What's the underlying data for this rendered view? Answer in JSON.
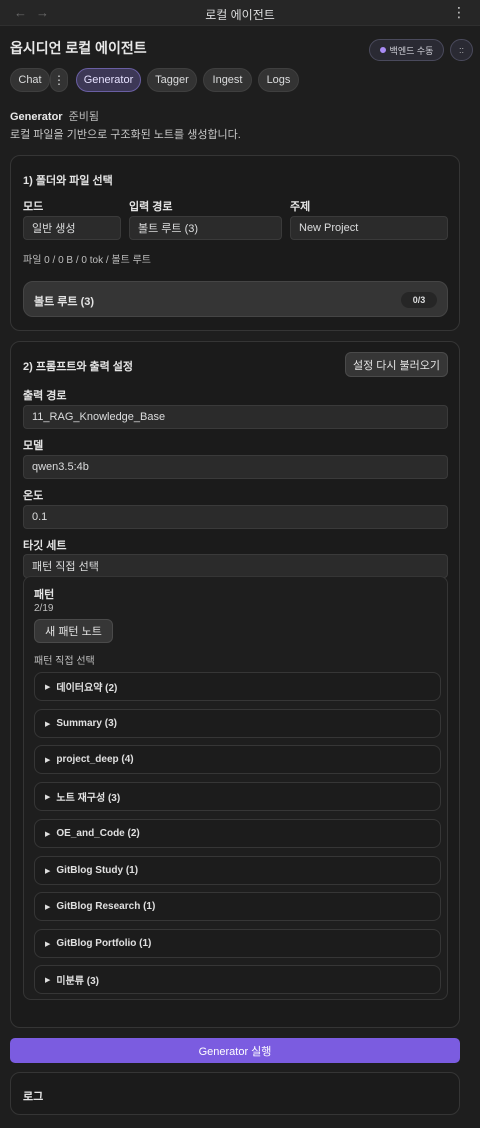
{
  "window": {
    "title": "로컬 에이전트",
    "back_icon": "←",
    "forward_icon": "→",
    "more_icon": "⋮"
  },
  "header": {
    "title": "옵시디언 로컬 에이전트",
    "backend_badge": "백엔드 수동",
    "grip_icon": "::"
  },
  "tabs": [
    {
      "label": "Chat"
    },
    {
      "label": "⋮"
    },
    {
      "label": "Generator"
    },
    {
      "label": "Tagger"
    },
    {
      "label": "Ingest"
    },
    {
      "label": "Logs"
    }
  ],
  "generator": {
    "name": "Generator",
    "status": "준비됨",
    "description": "로컬 파일을 기반으로 구조화된 노트를 생성합니다."
  },
  "section1": {
    "title": "1) 폴더와 파일 선택",
    "mode_label": "모드",
    "mode_value": "일반 생성",
    "input_label": "입력 경로",
    "input_value": "볼트 루트 (3)",
    "topic_label": "주제",
    "topic_value": "New Project",
    "file_stats": "파일 0 / 0 B / 0 tok / 볼트 루트",
    "vault_label": "볼트 루트 (3)",
    "vault_count": "0/3"
  },
  "section2": {
    "title": "2) 프롬프트와 출력 설정",
    "reload_button": "설정 다시 불러오기",
    "output_label": "출력 경로",
    "output_value": "11_RAG_Knowledge_Base",
    "model_label": "모델",
    "model_value": "qwen3.5:4b",
    "temp_label": "온도",
    "temp_value": "0.1",
    "target_label": "타깃 세트",
    "target_value": "패턴 직접 선택"
  },
  "patterns": {
    "title": "패턴",
    "count": "2/19",
    "new_button": "새 패턴 노트",
    "subtitle": "패턴 직접 선택",
    "groups": [
      {
        "label": "데이터요약 (2)"
      },
      {
        "label": "Summary (3)"
      },
      {
        "label": "project_deep (4)"
      },
      {
        "label": "노트 재구성 (3)"
      },
      {
        "label": "OE_and_Code (2)"
      },
      {
        "label": "GitBlog Study (1)"
      },
      {
        "label": "GitBlog Research (1)"
      },
      {
        "label": "GitBlog Portfolio (1)"
      },
      {
        "label": "미분류 (3)"
      }
    ]
  },
  "run_button": "Generator 실행",
  "log": {
    "title": "로그"
  },
  "colors": {
    "accent": "#7b5ce0",
    "active_tab": "#3d3856",
    "background": "#1e1e1e"
  }
}
